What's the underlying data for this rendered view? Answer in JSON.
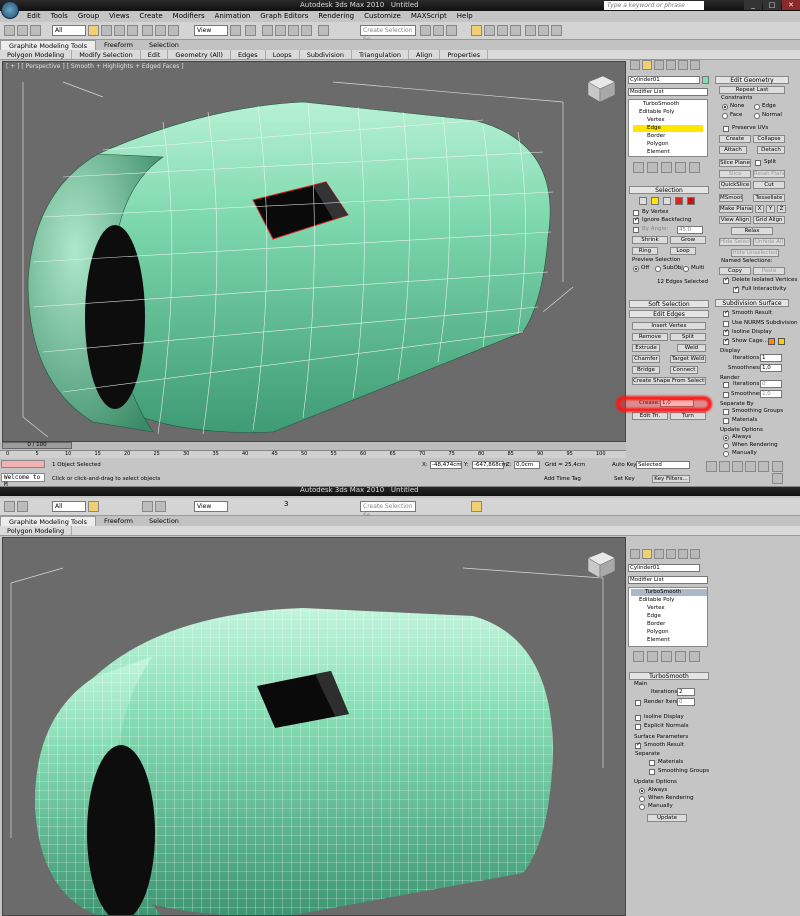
{
  "app": {
    "title": "Autodesk 3ds Max 2010",
    "file": "Untitled",
    "search_placeholder": "Type a keyword or phrase"
  },
  "menu": [
    "Edit",
    "Tools",
    "Group",
    "Views",
    "Create",
    "Modifiers",
    "Animation",
    "Graph Editors",
    "Rendering",
    "Customize",
    "MAXScript",
    "Help"
  ],
  "toolbar": {
    "filter": "All",
    "view": "View",
    "named_sel": "Create Selection Se",
    "snap_value": "3"
  },
  "ribbon_tabs": [
    "Graphite Modeling Tools",
    "Freeform",
    "Selection"
  ],
  "ribbon_top": [
    "Polygon Modeling",
    "Modify Selection",
    "Edit",
    "Geometry (All)",
    "Edges",
    "Loops",
    "Subdivision",
    "Triangulation",
    "Align",
    "Properties"
  ],
  "ribbon_bottom": [
    "Polygon Modeling"
  ],
  "viewport_label": "[ + ] [ Perspective ] [ Smooth + Highlights + Edged Faces ]",
  "object_name": "Cylinder01",
  "modifier_list": "Modifier List",
  "stack_top": [
    "TurboSmooth",
    "Editable Poly",
    "Vertex",
    "Edge",
    "Border",
    "Polygon",
    "Element"
  ],
  "selection": {
    "title": "Selection",
    "by_vertex": "By Vertex",
    "ignore_backfacing": "Ignore Backfacing",
    "by_angle": "By Angle:",
    "angle": "45,0",
    "shrink": "Shrink",
    "grow": "Grow",
    "ring": "Ring",
    "loop": "Loop",
    "preview": "Preview Selection",
    "off": "Off",
    "subobj": "SubObj",
    "multi": "Multi",
    "status": "12 Edges Selected"
  },
  "soft_selection": "Soft Selection",
  "edit_edges": {
    "title": "Edit Edges",
    "insert_vertex": "Insert Vertex",
    "remove": "Remove",
    "split": "Split",
    "extrude": "Extrude",
    "weld": "Weld",
    "chamfer": "Chamfer",
    "target_weld": "Target Weld",
    "bridge": "Bridge",
    "connect": "Connect",
    "create_shape": "Create Shape From Selection",
    "crease_label": "Crease:",
    "crease_value": "1,0",
    "edit_tri": "Edit Tri.",
    "turn": "Turn"
  },
  "edit_geometry": {
    "title": "Edit Geometry",
    "repeat_last": "Repeat Last",
    "constraints": "Constraints",
    "none": "None",
    "edge": "Edge",
    "face": "Face",
    "normal": "Normal",
    "preserve_uvs": "Preserve UVs",
    "create": "Create",
    "collapse": "Collapse",
    "attach": "Attach",
    "detach": "Detach",
    "slice_plane": "Slice Plane",
    "split": "Split",
    "slice": "Slice",
    "reset_plane": "Reset Plane",
    "quickslice": "QuickSlice",
    "cut": "Cut",
    "msmooth": "MSmooth",
    "tessellate": "Tessellate",
    "make_planar": "Make Planar",
    "x": "X",
    "y": "Y",
    "z": "Z",
    "view_align": "View Align",
    "grid_align": "Grid Align",
    "relax": "Relax",
    "hide_selected": "Hide Selected",
    "unhide_all": "Unhide All",
    "hide_unselected": "Hide Unselected",
    "named_selections": "Named Selections:",
    "copy": "Copy",
    "paste": "Paste",
    "delete_isolated": "Delete Isolated Vertices",
    "full_interactivity": "Full Interactivity"
  },
  "subdivision_surface": {
    "title": "Subdivision Surface",
    "smooth_result": "Smooth Result",
    "use_nurms": "Use NURMS Subdivision",
    "isoline": "Isoline Display",
    "show_cage": "Show Cage......",
    "display": "Display",
    "iterations": "Iterations:",
    "iter_val": "1",
    "smoothness": "Smoothness:",
    "smooth_val": "1,0",
    "render": "Render",
    "r_iter_val": "0",
    "r_smooth_val": "1,0",
    "separate_by": "Separate By",
    "smoothing_groups": "Smoothing Groups",
    "materials": "Materials",
    "update_options": "Update Options",
    "always": "Always",
    "when_rendering": "When Rendering",
    "manually": "Manually"
  },
  "timeline": {
    "frame": "0 / 100",
    "ticks": [
      "0",
      "5",
      "10",
      "15",
      "20",
      "25",
      "30",
      "35",
      "40",
      "45",
      "50",
      "55",
      "60",
      "65",
      "70",
      "75",
      "80",
      "85",
      "90",
      "95",
      "100"
    ]
  },
  "status": {
    "welcome": "Welcome to M",
    "objects": "1 Object Selected",
    "prompt": "Click or click-and-drag to select objects",
    "x_label": "X:",
    "x": "-48,474cm",
    "y_label": "Y:",
    "y": "-647,868cm",
    "z_label": "Z:",
    "z": "0,0cm",
    "grid": "Grid = 25,4cm",
    "auto_key": "Auto Key",
    "selected": "Selected",
    "set_key": "Set Key",
    "key_filters": "Key Filters...",
    "add_time_tag": "Add Time Tag"
  },
  "turbosmooth": {
    "title": "TurboSmooth",
    "main": "Main",
    "iterations": "Iterations:",
    "iter_val": "2",
    "render_iters": "Render Iters:",
    "render_val": "0",
    "isoline": "Isoline Display",
    "explicit_normals": "Explicit Normals",
    "surface_params": "Surface Parameters",
    "smooth_result": "Smooth Result",
    "separate": "Separate",
    "materials": "Materials",
    "smoothing_groups": "Smoothing Groups",
    "update_options": "Update Options",
    "always": "Always",
    "when_rendering": "When Rendering",
    "manually": "Manually",
    "update": "Update"
  },
  "colors": {
    "mesh": "#6fd1a3",
    "viewport_bg": "#6b6b6b",
    "highlight": "#ffe600",
    "red_marker": "#ff1515"
  }
}
